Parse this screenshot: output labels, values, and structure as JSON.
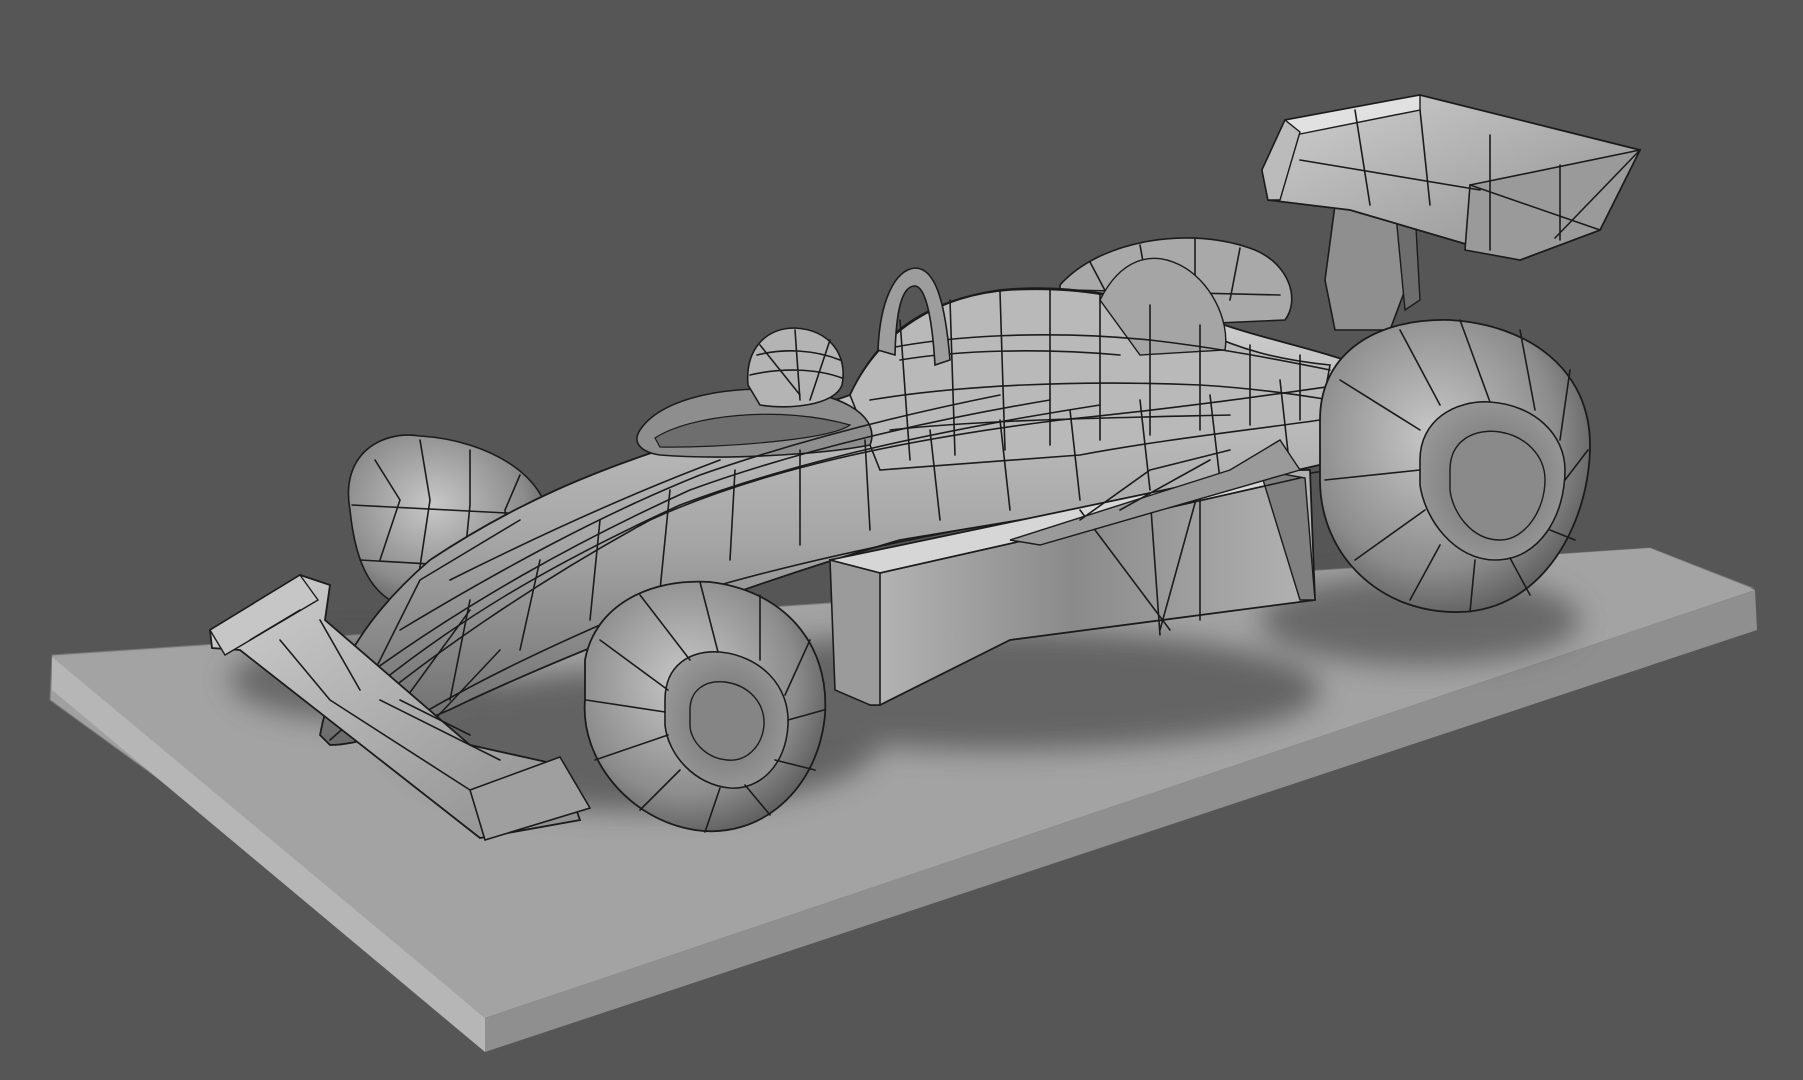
{
  "viewport": {
    "background": "#565656",
    "mode": "wireframe-on-shaded"
  },
  "scene": {
    "subject": "car-icon",
    "base": "base-icon"
  },
  "colors": {
    "background": "#565656",
    "surface_light": "#c9c9c9",
    "surface_mid": "#9a9a9a",
    "surface_dark": "#5e5e5e",
    "wire": "#1b1b1b",
    "shadow": "#3a3a3a"
  }
}
